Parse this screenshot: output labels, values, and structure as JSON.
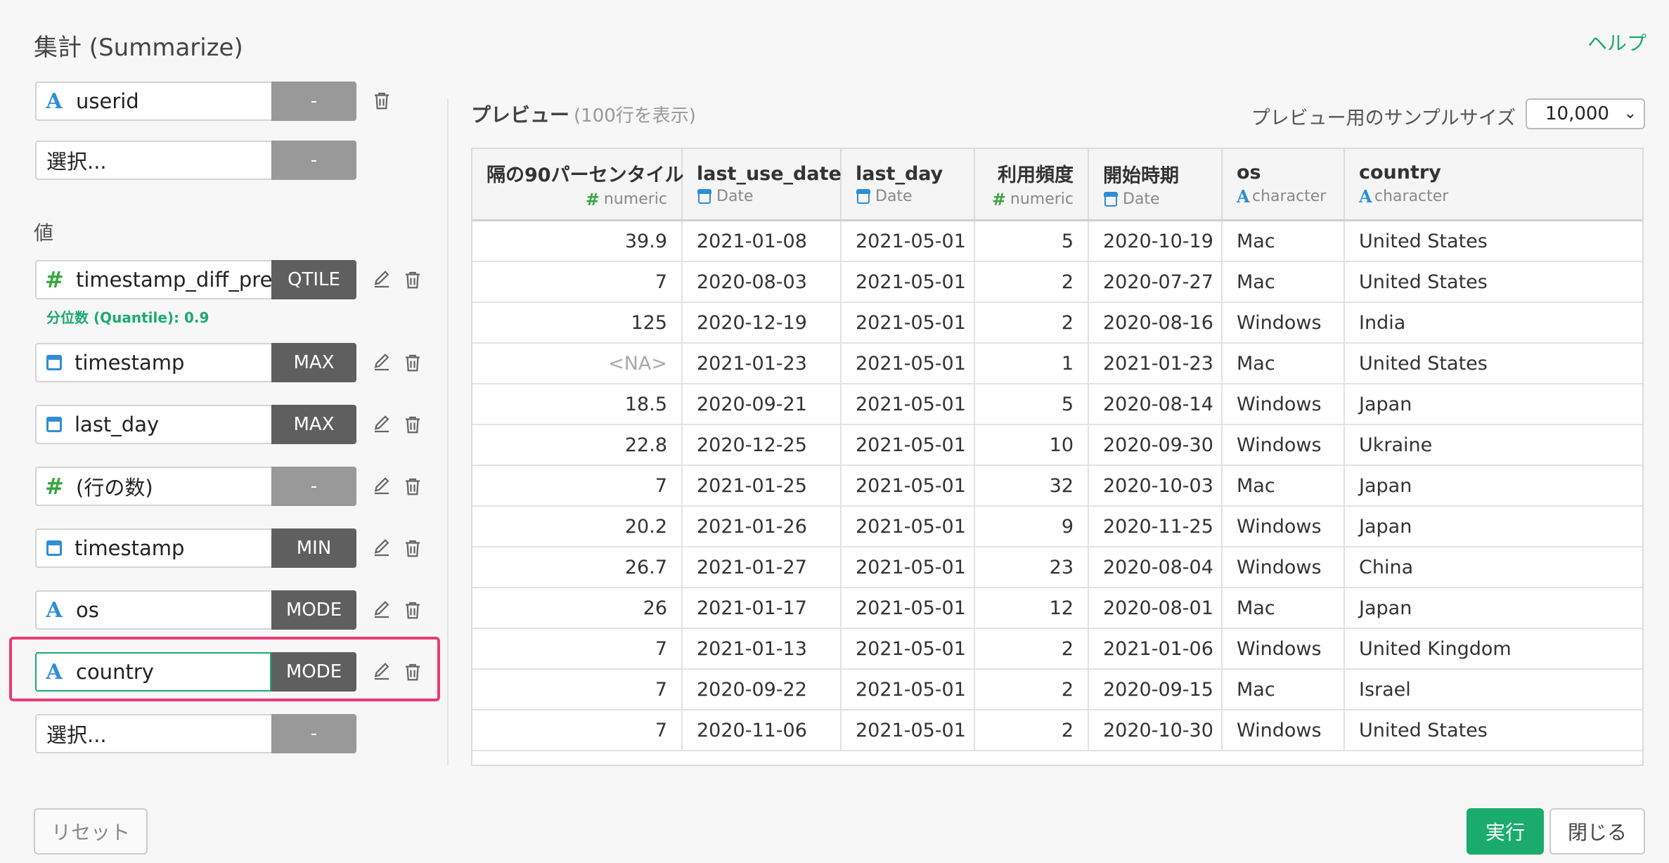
{
  "header": {
    "title": "集計 (Summarize)",
    "help_label": "ヘルプ"
  },
  "groups": [
    {
      "icon": "A",
      "label": "userid",
      "agg": "-"
    },
    {
      "icon": "",
      "label": "選択...",
      "agg": "-"
    }
  ],
  "values_section": {
    "label": "値",
    "quantile_note": "分位数 (Quantile): 0.9",
    "items": [
      {
        "icon": "#",
        "label": "timestamp_diff_prev",
        "agg": "QTILE"
      },
      {
        "icon": "cal",
        "label": "timestamp",
        "agg": "MAX"
      },
      {
        "icon": "cal",
        "label": "last_day",
        "agg": "MAX"
      },
      {
        "icon": "#",
        "label": "(行の数)",
        "agg": "-"
      },
      {
        "icon": "cal",
        "label": "timestamp",
        "agg": "MIN"
      },
      {
        "icon": "A",
        "label": "os",
        "agg": "MODE"
      },
      {
        "icon": "A",
        "label": "country",
        "agg": "MODE"
      },
      {
        "icon": "",
        "label": "選択...",
        "agg": "-"
      }
    ]
  },
  "preview": {
    "title": "プレビュー",
    "subtitle": "(100行を表示)",
    "sample_label": "プレビュー用のサンプルサイズ",
    "sample_value": "10,000",
    "columns": [
      {
        "name": "隔の90パーセンタイル",
        "type": "numeric"
      },
      {
        "name": "last_use_date",
        "type": "Date"
      },
      {
        "name": "last_day",
        "type": "Date"
      },
      {
        "name": "利用頻度",
        "type": "numeric"
      },
      {
        "name": "開始時期",
        "type": "Date"
      },
      {
        "name": "os",
        "type": "character"
      },
      {
        "name": "country",
        "type": "character"
      }
    ],
    "rows": [
      [
        "39.9",
        "2021-01-08",
        "2021-05-01",
        "5",
        "2020-10-19",
        "Mac",
        "United States"
      ],
      [
        "7",
        "2020-08-03",
        "2021-05-01",
        "2",
        "2020-07-27",
        "Mac",
        "United States"
      ],
      [
        "125",
        "2020-12-19",
        "2021-05-01",
        "2",
        "2020-08-16",
        "Windows",
        "India"
      ],
      [
        "<NA>",
        "2021-01-23",
        "2021-05-01",
        "1",
        "2021-01-23",
        "Mac",
        "United States"
      ],
      [
        "18.5",
        "2020-09-21",
        "2021-05-01",
        "5",
        "2020-08-14",
        "Windows",
        "Japan"
      ],
      [
        "22.8",
        "2020-12-25",
        "2021-05-01",
        "10",
        "2020-09-30",
        "Windows",
        "Ukraine"
      ],
      [
        "7",
        "2021-01-25",
        "2021-05-01",
        "32",
        "2020-10-03",
        "Mac",
        "Japan"
      ],
      [
        "20.2",
        "2021-01-26",
        "2021-05-01",
        "9",
        "2020-11-25",
        "Windows",
        "Japan"
      ],
      [
        "26.7",
        "2021-01-27",
        "2021-05-01",
        "23",
        "2020-08-04",
        "Windows",
        "China"
      ],
      [
        "26",
        "2021-01-17",
        "2021-05-01",
        "12",
        "2020-08-01",
        "Mac",
        "Japan"
      ],
      [
        "7",
        "2021-01-13",
        "2021-05-01",
        "2",
        "2021-01-06",
        "Windows",
        "United Kingdom"
      ],
      [
        "7",
        "2020-09-22",
        "2021-05-01",
        "2",
        "2020-09-15",
        "Mac",
        "Israel"
      ],
      [
        "7",
        "2020-11-06",
        "2021-05-01",
        "2",
        "2020-10-30",
        "Windows",
        "United States"
      ]
    ]
  },
  "footer": {
    "reset_label": "リセット",
    "run_label": "実行",
    "close_label": "閉じる"
  },
  "colors": {
    "accent": "#1bab6e",
    "highlight": "#ea3b74",
    "char_icon": "#2e8ed6",
    "num_icon": "#3aa640"
  },
  "icons": {
    "character": "character-type-icon",
    "numeric": "numeric-type-icon",
    "date": "calendar-icon",
    "edit": "edit-icon",
    "delete": "trash-icon"
  }
}
